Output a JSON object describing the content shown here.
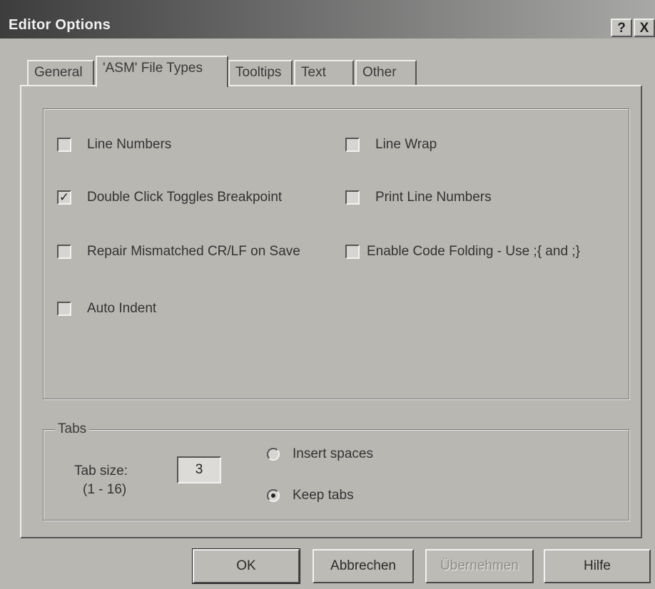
{
  "window": {
    "title": "Editor Options",
    "help_button": "?",
    "close_button": "X"
  },
  "tabs": [
    {
      "label": "General",
      "active": false
    },
    {
      "label": "'ASM' File Types",
      "active": true
    },
    {
      "label": "Tooltips",
      "active": false
    },
    {
      "label": "Text",
      "active": false
    },
    {
      "label": "Other",
      "active": false
    }
  ],
  "options": {
    "line_numbers": {
      "label": "Line Numbers",
      "checked": false
    },
    "line_wrap": {
      "label": "Line Wrap",
      "checked": false
    },
    "double_click": {
      "label": "Double Click Toggles Breakpoint",
      "checked": true,
      "mark": "✓"
    },
    "print_line_numbers": {
      "label": "Print Line Numbers",
      "checked": false
    },
    "repair_crlf": {
      "label": "Repair Mismatched CR/LF on Save",
      "checked": false
    },
    "code_folding": {
      "label": "Enable Code Folding - Use ;{ and ;}",
      "checked": false
    },
    "auto_indent": {
      "label": "Auto Indent",
      "checked": false
    }
  },
  "tabs_group": {
    "legend": "Tabs",
    "tab_size_label": "Tab size:",
    "tab_size_range": "(1 - 16)",
    "tab_size_value": "3",
    "insert_spaces": {
      "label": "Insert spaces",
      "selected": false
    },
    "keep_tabs": {
      "label": "Keep tabs",
      "selected": true
    }
  },
  "buttons": {
    "ok": "OK",
    "cancel": "Abbrechen",
    "apply": "Übernehmen",
    "help": "Hilfe"
  }
}
